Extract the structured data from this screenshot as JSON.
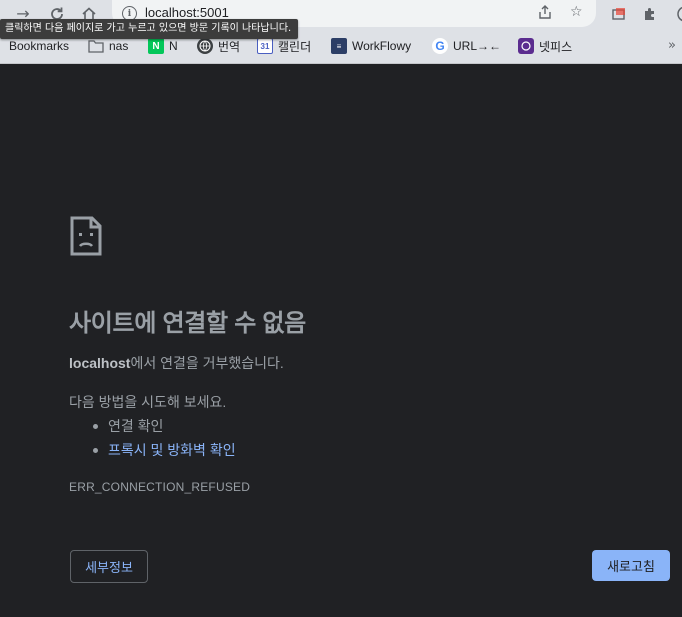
{
  "browser": {
    "url": "localhost:5001",
    "tooltip": "클릭하면 다음 페이지로 가고 누르고 있으면 방문 기록이 나타납니다.",
    "bookmarks": [
      {
        "label": "Bookmarks",
        "icon": "bookmarks-label"
      },
      {
        "label": "nas",
        "icon": "folder-icon"
      },
      {
        "label": "N",
        "icon": "naver-icon"
      },
      {
        "label": "번역",
        "icon": "globe-icon"
      },
      {
        "label": "캘린더",
        "icon": "calendar-icon",
        "badge": "31"
      },
      {
        "label": "WorkFlowy",
        "icon": "workflowy-icon"
      },
      {
        "label": "URL→←",
        "icon": "google-icon"
      },
      {
        "label": "넷피스",
        "icon": "netpis-icon"
      }
    ],
    "overflow": "»"
  },
  "error": {
    "title": "사이트에 연결할 수 없음",
    "host": "localhost",
    "message_rest": "에서 연결을 거부했습니다.",
    "suggest_heading": "다음 방법을 시도해 보세요.",
    "suggestions": [
      "연결 확인",
      "프록시 및 방화벽 확인"
    ],
    "code": "ERR_CONNECTION_REFUSED",
    "details_button": "세부정보",
    "reload_button": "새로고침"
  },
  "colors": {
    "page_bg": "#202124",
    "text": "#9aa0a6",
    "link": "#8ab4f8",
    "reload_bg": "#8ab4f8"
  }
}
